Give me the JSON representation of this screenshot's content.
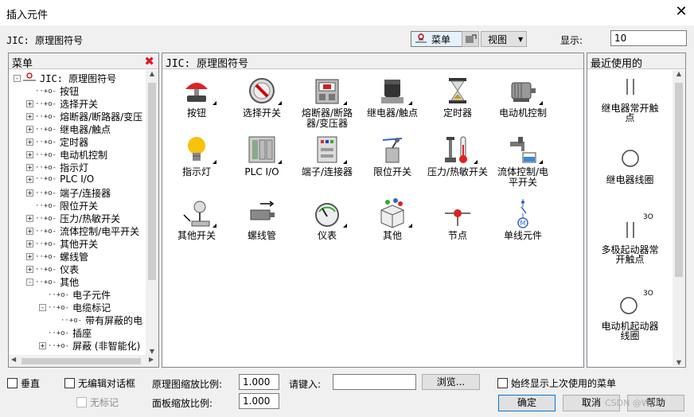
{
  "window": {
    "title": "插入元件",
    "close_glyph": "✕"
  },
  "header": {
    "library_label": "JIC: 原理图符号",
    "menu_button": "菜单",
    "view_button": "视图",
    "show_label": "显示:",
    "show_value": "10"
  },
  "menu_panel": {
    "title": "菜单",
    "close_glyph": "✖",
    "tree": [
      {
        "label": "JIC: 原理图符号",
        "expander": "⊟"
      },
      {
        "label": "按钮",
        "expander": ""
      },
      {
        "label": "选择开关",
        "expander": "+"
      },
      {
        "label": "熔断器/断路器/变压",
        "expander": "+"
      },
      {
        "label": "继电器/触点",
        "expander": "+"
      },
      {
        "label": "定时器",
        "expander": "+"
      },
      {
        "label": "电动机控制",
        "expander": "+"
      },
      {
        "label": "指示灯",
        "expander": "+"
      },
      {
        "label": "PLC I/O",
        "expander": "+"
      },
      {
        "label": "端子/连接器",
        "expander": "+"
      },
      {
        "label": "限位开关",
        "expander": ""
      },
      {
        "label": "压力/热敏开关",
        "expander": "+"
      },
      {
        "label": "流体控制/电平开关",
        "expander": "+"
      },
      {
        "label": "其他开关",
        "expander": "+"
      },
      {
        "label": "螺线管",
        "expander": "+"
      },
      {
        "label": "仪表",
        "expander": "+"
      },
      {
        "label": "其他",
        "expander": "-"
      },
      {
        "label": "电子元件",
        "expander": ""
      },
      {
        "label": "电缆标记",
        "expander": "-"
      },
      {
        "label": "带有屏蔽的电",
        "expander": ""
      },
      {
        "label": "插座",
        "expander": ""
      },
      {
        "label": "屏蔽 (非智能化)",
        "expander": "+"
      }
    ]
  },
  "symbol_panel": {
    "title": "JIC: 原理图符号",
    "items": [
      {
        "label": "按钮",
        "icon": "pushbutton-icon"
      },
      {
        "label": "选择开关",
        "icon": "selector-switch-icon"
      },
      {
        "label": "熔断器/断路器/变压器",
        "icon": "fuse-breaker-icon"
      },
      {
        "label": "继电器/触点",
        "icon": "relay-icon"
      },
      {
        "label": "定时器",
        "icon": "hourglass-icon"
      },
      {
        "label": "电动机控制",
        "icon": "motor-icon"
      },
      {
        "label": "指示灯",
        "icon": "lightbulb-icon"
      },
      {
        "label": "PLC I/O",
        "icon": "plc-icon"
      },
      {
        "label": "端子/连接器",
        "icon": "terminal-icon"
      },
      {
        "label": "限位开关",
        "icon": "limit-switch-icon"
      },
      {
        "label": "压力/热敏开关",
        "icon": "pressure-thermo-icon"
      },
      {
        "label": "流体控制/电平开关",
        "icon": "fluid-control-icon"
      },
      {
        "label": "其他开关",
        "icon": "other-switch-icon"
      },
      {
        "label": "螺线管",
        "icon": "solenoid-icon"
      },
      {
        "label": "仪表",
        "icon": "meter-icon"
      },
      {
        "label": "其他",
        "icon": "other-box-icon"
      },
      {
        "label": "节点",
        "icon": "node-icon"
      },
      {
        "label": "单线元件",
        "icon": "single-line-icon"
      }
    ]
  },
  "recent_panel": {
    "title": "最近使用的",
    "items": [
      {
        "label": "继电器常开触点",
        "annot": ""
      },
      {
        "label": "继电器线圈",
        "annot": ""
      },
      {
        "label": "多极起动器常开触点",
        "annot": "3O"
      },
      {
        "label": "电动机起动器线圈",
        "annot": "3O"
      }
    ]
  },
  "footer": {
    "vertical_label": "垂直",
    "no_edit_dialog_label": "无编辑对话框",
    "no_tag_label": "无标记",
    "schematic_scale_label": "原理图缩放比例:",
    "schematic_scale_value": "1.000",
    "panel_scale_label": "面板缩放比例:",
    "panel_scale_value": "1.000",
    "enter_label": "请键入:",
    "enter_value": "",
    "browse_label": "浏览...",
    "always_show_label": "始终显示上次使用的菜单",
    "ok_label": "确定",
    "cancel_label": "取消",
    "help_label": "帮助",
    "watermark": "CSDN @WRF*"
  },
  "colors": {
    "accent": "#0078d7",
    "close_red": "#e81123"
  }
}
